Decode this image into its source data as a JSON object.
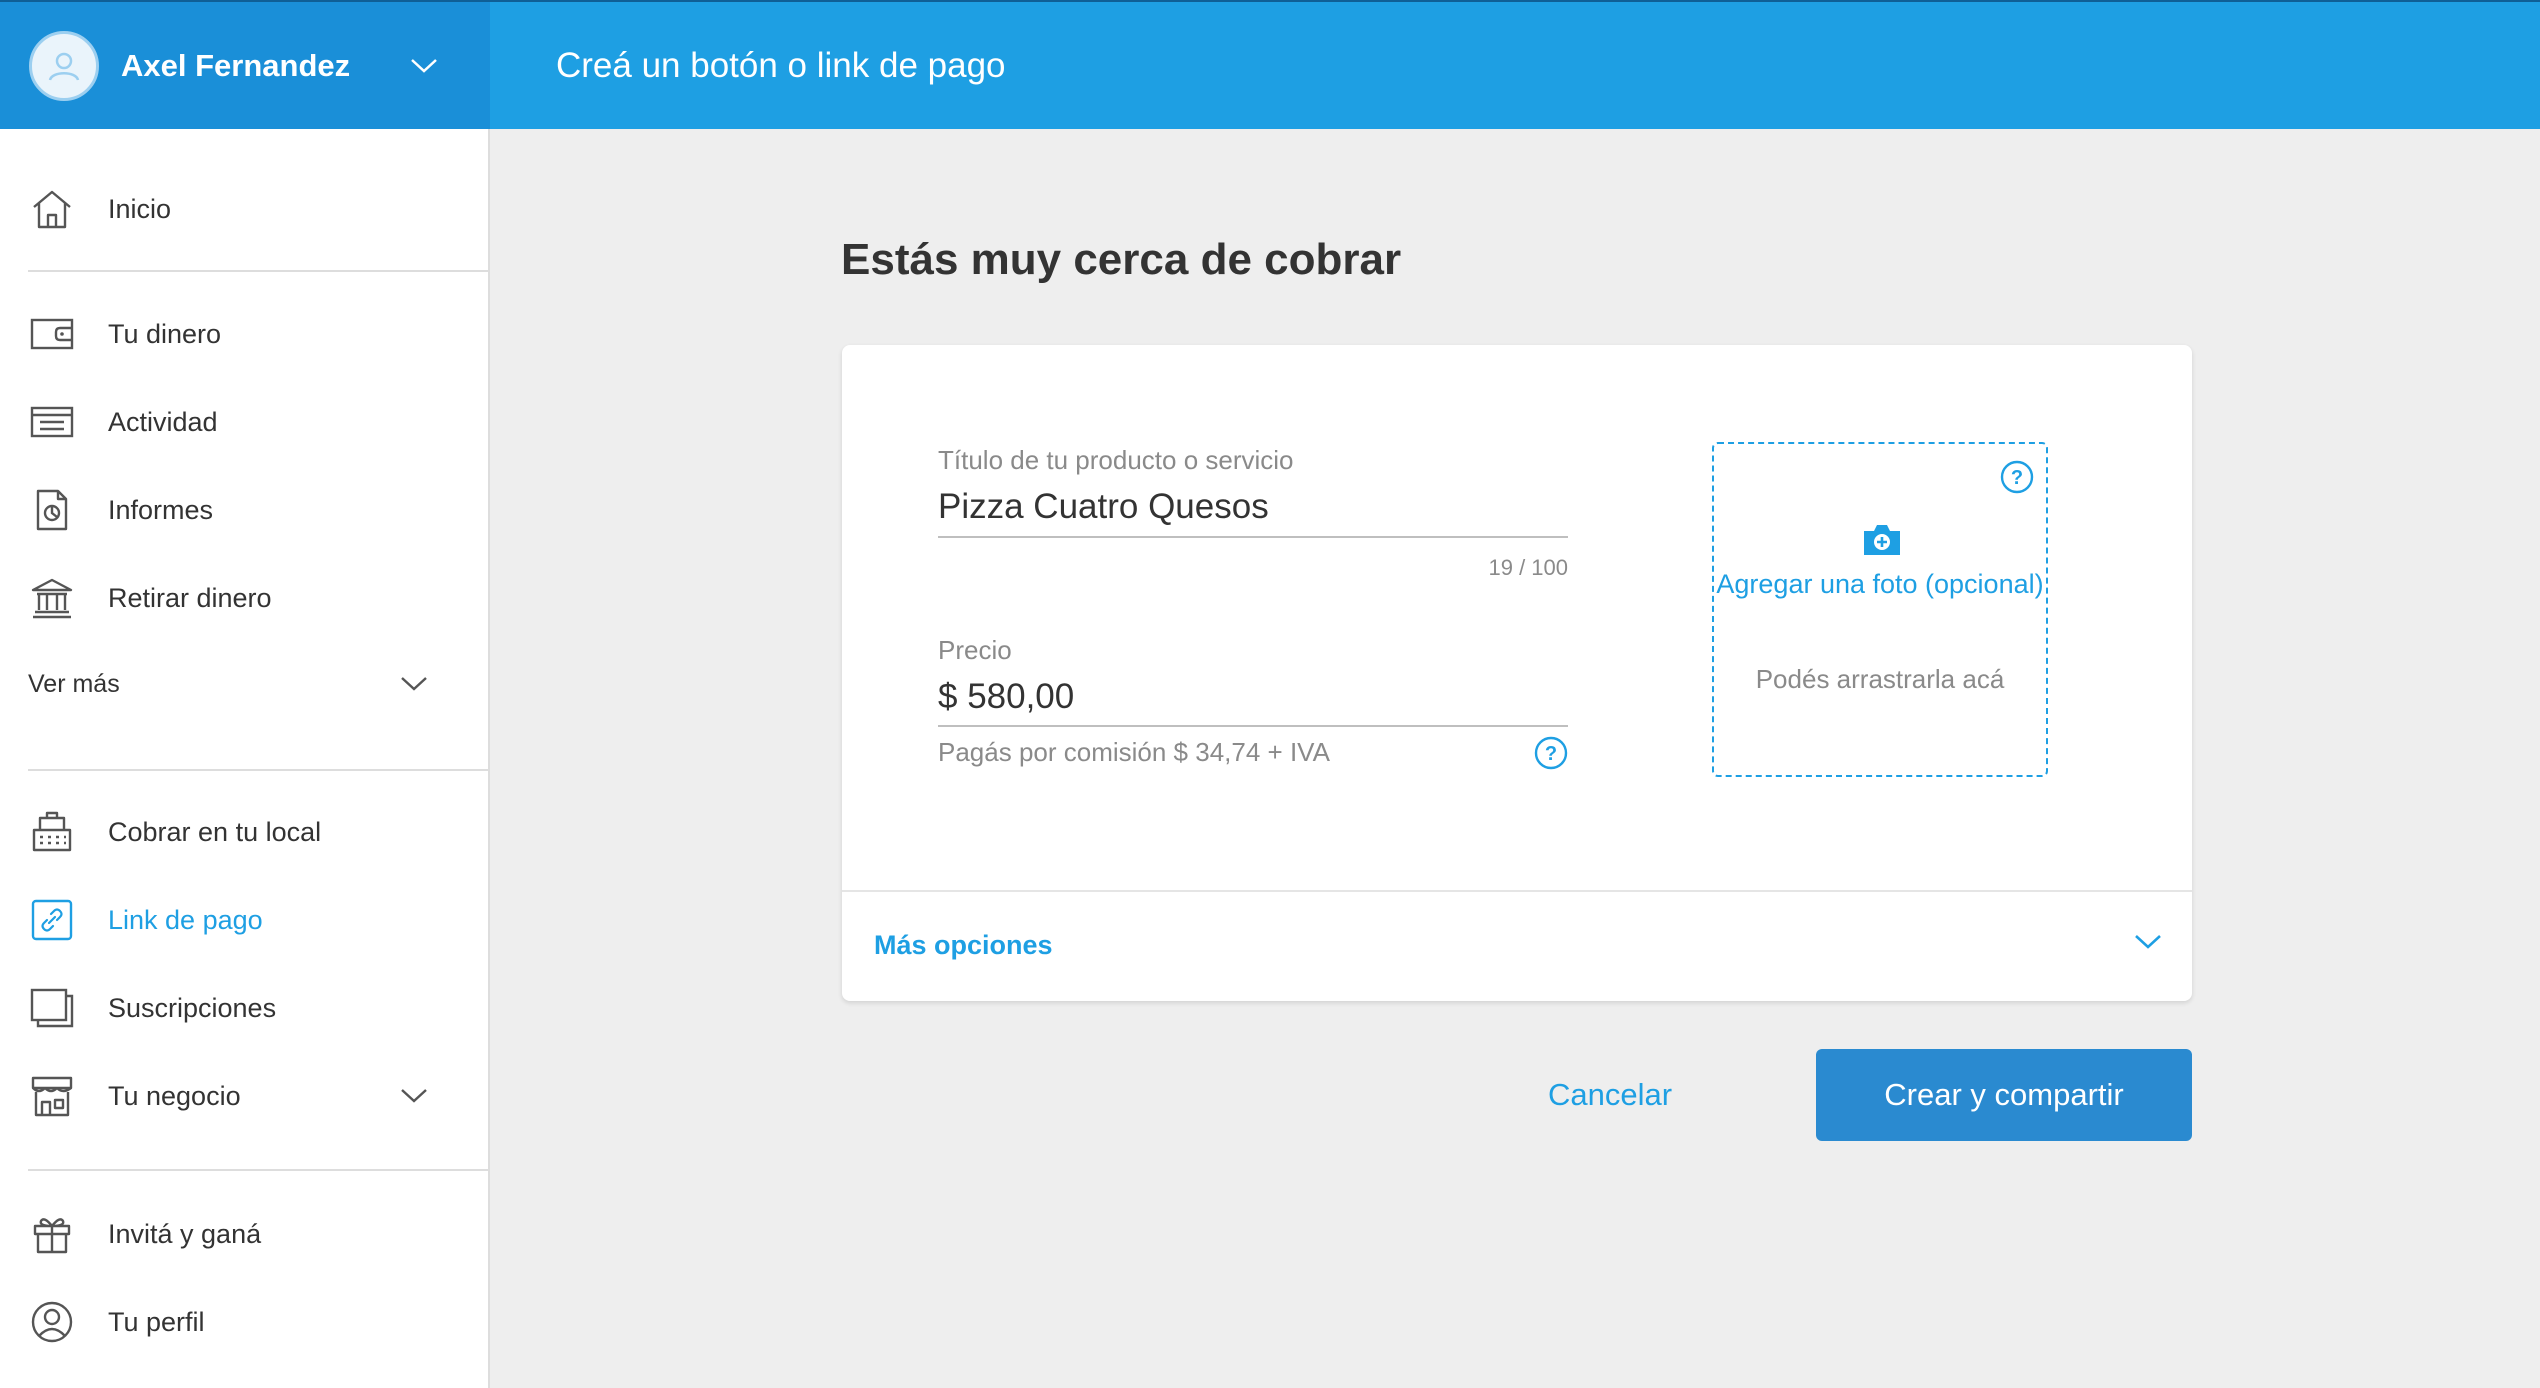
{
  "header": {
    "user_name": "Axel Fernandez",
    "page_title": "Creá un botón o link de pago"
  },
  "sidebar": {
    "items": [
      {
        "label": "Inicio",
        "icon": "home-icon"
      },
      {
        "label": "Tu dinero",
        "icon": "wallet-icon"
      },
      {
        "label": "Actividad",
        "icon": "activity-list-icon"
      },
      {
        "label": "Informes",
        "icon": "report-document-icon"
      },
      {
        "label": "Retirar dinero",
        "icon": "bank-icon"
      },
      {
        "label": "Ver más"
      },
      {
        "label": "Cobrar en tu local",
        "icon": "cash-register-icon"
      },
      {
        "label": "Link de pago",
        "icon": "payment-link-icon",
        "active": true
      },
      {
        "label": "Suscripciones",
        "icon": "subscriptions-icon"
      },
      {
        "label": "Tu negocio",
        "icon": "store-icon"
      },
      {
        "label": "Invitá y ganá",
        "icon": "gift-icon"
      },
      {
        "label": "Tu perfil",
        "icon": "profile-icon"
      }
    ]
  },
  "main": {
    "title": "Estás muy cerca de cobrar",
    "product_title": {
      "label": "Título de tu producto o servicio",
      "value": "Pizza Cuatro Quesos",
      "counter": "19 / 100"
    },
    "price": {
      "label": "Precio",
      "value": "$ 580,00",
      "commission": "Pagás por comisión $ 34,74 + IVA"
    },
    "photo": {
      "cta": "Agregar una foto (opcional)",
      "subtitle": "Podés arrastrarla acá"
    },
    "more_options": "Más opciones",
    "cancel": "Cancelar",
    "submit": "Crear y compartir"
  },
  "colors": {
    "header_left": "#1a8fd8",
    "header_right": "#1e9fe3",
    "accent": "#1e9fe3",
    "primary_button": "#2a8ad0"
  }
}
